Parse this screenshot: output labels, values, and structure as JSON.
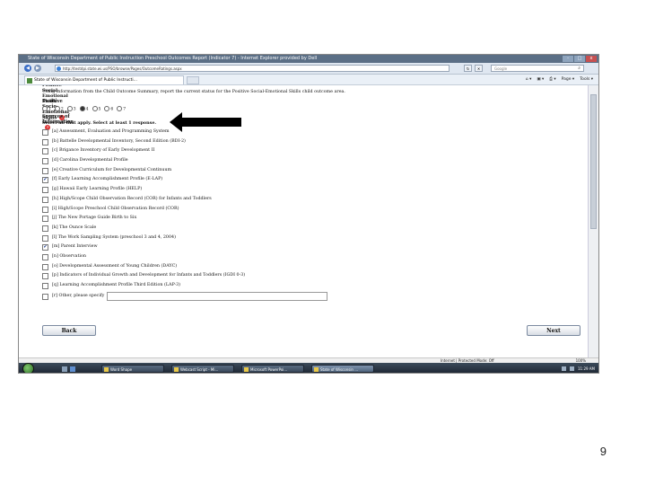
{
  "window": {
    "title": "State of Wisconsin Department of Public Instruction Preschool Outcomes Report (Indicator 7) - Internet Explorer provided by Dell",
    "controls": [
      "-",
      "□",
      "x"
    ]
  },
  "address": {
    "url": "http://testdpi.state.wi.us/PSO/browse/Pages/OutcomeRatings.aspx",
    "search_placeholder": "Google"
  },
  "tabs": [
    {
      "label": "State of Wisconsin Department of Public Instructi..."
    }
  ],
  "commands": {
    "page": "Page",
    "tools": "Tools"
  },
  "form": {
    "cut_heading": "Positive Social-Emotional Skills",
    "intro": "Using information from the Child Outcome Summary, report the current status for the Positive Social-Emotional Skills child outcome area.",
    "question_title": "Positive Socio-Emotional Skills",
    "ratings": [
      {
        "label": "1",
        "selected": false
      },
      {
        "label": "2",
        "selected": false
      },
      {
        "label": "3",
        "selected": false
      },
      {
        "label": "4",
        "selected": true
      },
      {
        "label": "5",
        "selected": false
      },
      {
        "label": "6",
        "selected": false
      },
      {
        "label": "7",
        "selected": false
      }
    ],
    "sources_title": "Sources of Information",
    "sources_instruction": "Select all that apply. Select at least 1 response.",
    "sources": [
      {
        "label": "[a] Assessment, Evaluation and Programming System",
        "checked": false
      },
      {
        "label": "[b] Battelle Developmental Inventory, Second Edition (BDI-2)",
        "checked": false
      },
      {
        "label": "[c] Brigance Inventory of Early Development II",
        "checked": false
      },
      {
        "label": "[d] Carolina Developmental Profile",
        "checked": false
      },
      {
        "label": "[e] Creative Curriculum for Developmental Continuum",
        "checked": false
      },
      {
        "label": "[f] Early Learning Accomplishment Profile (E-LAP)",
        "checked": true
      },
      {
        "label": "[g] Hawaii Early Learning Profile (HELP)",
        "checked": false
      },
      {
        "label": "[h] High/Scope Child Observation Record (COR) for Infants and Toddlers",
        "checked": false
      },
      {
        "label": "[i] High/Scope Preschool Child Observation Record (COR)",
        "checked": false
      },
      {
        "label": "[j] The New Portage Guide Birth to Six",
        "checked": false
      },
      {
        "label": "[k] The Ounce Scale",
        "checked": false
      },
      {
        "label": "[l] The Work Sampling System (preschool 3 and 4, 2004)",
        "checked": false
      },
      {
        "label": "[m] Parent Interview",
        "checked": true
      },
      {
        "label": "[n] Observation",
        "checked": false
      },
      {
        "label": "[o] Developmental Assessment of Young Children (DAYC)",
        "checked": false
      },
      {
        "label": "[p] Indicators of Individual Growth and Development for Infants and Toddlers (IGDI 0-3)",
        "checked": false
      },
      {
        "label": "[q] Learning Accomplishment Profile Third Edition (LAP-3)",
        "checked": false
      }
    ],
    "other_label": "[r] Other, please specify",
    "other_value": "",
    "back_label": "Back",
    "next_label": "Next"
  },
  "status": {
    "zone": "Internet | Protected Mode: Off",
    "zoom": "100%"
  },
  "taskbar": {
    "items": [
      {
        "label": "Word Shape",
        "active": false
      },
      {
        "label": "Webcast Script - Mi...",
        "active": false
      },
      {
        "label": "Microsoft PowerPoi...",
        "active": false
      },
      {
        "label": "State of Wisconsin ...",
        "active": true
      }
    ],
    "clock": "11:29 AM"
  },
  "slide": {
    "page_number": "9"
  }
}
